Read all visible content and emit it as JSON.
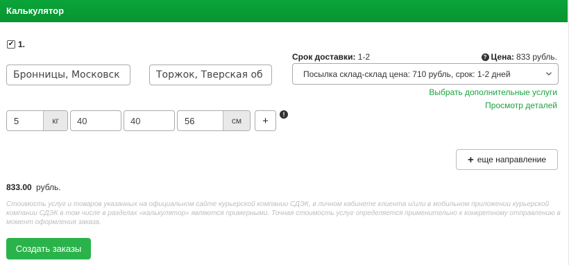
{
  "header": {
    "title": "Калькулятор"
  },
  "item": {
    "checked": true,
    "number": "1."
  },
  "route": {
    "from_value": "Бронницы, Московск",
    "to_value": "Торжок, Тверская об"
  },
  "delivery": {
    "term_label": "Срок доставки:",
    "term_value": "1-2",
    "price_label": "Цена:",
    "price_value": "833 рубль.",
    "tariff_selected": "Посылка склад-склад цена: 710 рубль, срок: 1-2 дней",
    "extra_services_link": "Выбрать дополнительные услуги",
    "details_link": "Просмотр деталей"
  },
  "package": {
    "weight": "5",
    "weight_unit": "кг",
    "length": "40",
    "width": "40",
    "height": "56",
    "size_unit": "см",
    "add_label": "+"
  },
  "add_direction_label": "еще направление",
  "total": {
    "amount": "833.00",
    "currency": "рубль."
  },
  "disclaimer": "Стоимость услуг и товаров указанных на официальном сайте курьерской компании СДЭК, в личном кабинете клиента и/или в мобильном приложении курьерской компании СДЭК в том числе в разделах «калькулятор» являются примерными. Точная стоимость услуг определяется применительно к конкретному отправлению в момент оформления заказа.",
  "create_orders_label": "Создать заказы",
  "icons": {
    "check": "✔",
    "help": "?",
    "warning": "!"
  },
  "colors": {
    "header_bg": "#0aa43a",
    "link": "#1aa33f",
    "primary_button": "#2bb34b"
  }
}
